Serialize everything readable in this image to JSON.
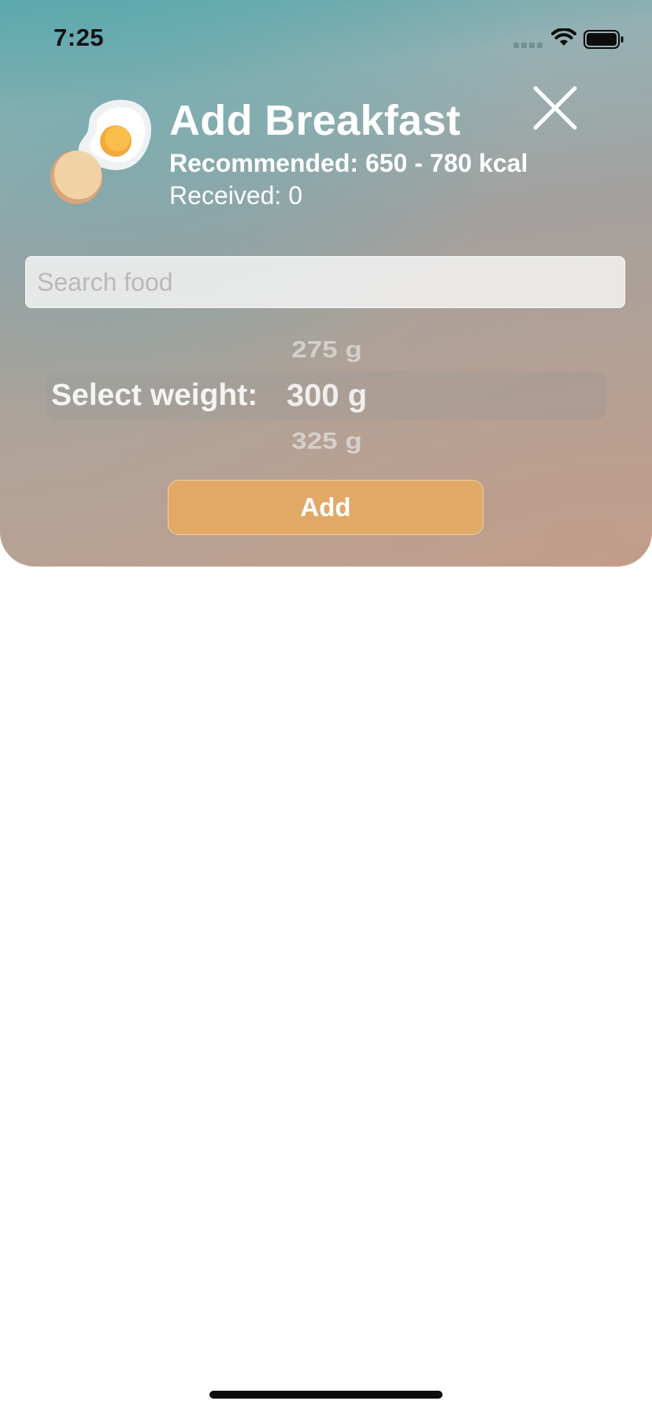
{
  "status_bar": {
    "time": "7:25",
    "signal_icon": "signal-dots-icon",
    "wifi_icon": "wifi-icon",
    "battery_icon": "battery-full-icon"
  },
  "header": {
    "icon": "fried-egg-icon",
    "title": "Add Breakfast",
    "recommended": "Recommended: 650 - 780 kcal",
    "received": "Received: 0",
    "close_icon": "close-icon"
  },
  "search": {
    "placeholder": "Search food",
    "value": ""
  },
  "weight_picker": {
    "label": "Select weight:",
    "previous": "275 g",
    "selected": "300 g",
    "next": "325 g"
  },
  "add_button": {
    "label": "Add"
  },
  "colors": {
    "accent_button": "#e0a966",
    "gradient_top": "#5ca8ad",
    "gradient_bottom": "#bea08e"
  }
}
